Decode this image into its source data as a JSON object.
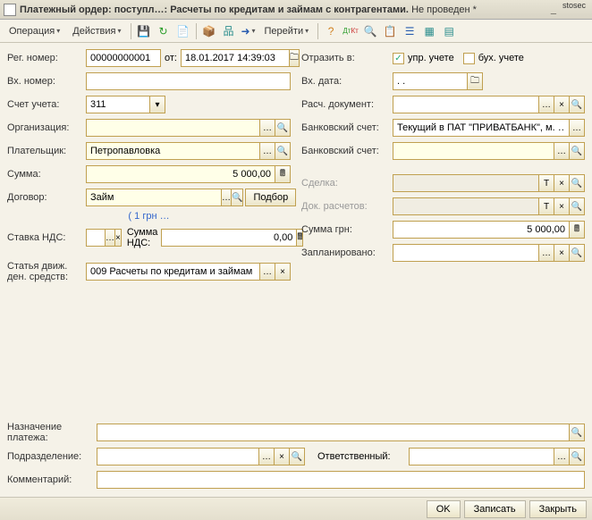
{
  "title": {
    "main": "Платежный ордер: поступл…: Расчеты по кредитам и займам с контрагентами.",
    "status": "Не проведен *",
    "brand": "stosec"
  },
  "menu": {
    "operation": "Операция",
    "actions": "Действия",
    "goto": "Перейти"
  },
  "labels": {
    "reg_no": "Рег. номер:",
    "from": "от:",
    "in_no": "Вх. номер:",
    "account": "Счет учета:",
    "org": "Организация:",
    "payer": "Плательщик:",
    "sum": "Сумма:",
    "contract": "Договор:",
    "select": "Подбор",
    "vat_rate": "Ставка НДС:",
    "vat_sum": "Сумма НДС:",
    "article1": "Статья движ.",
    "article2": "ден. средств:",
    "purpose1": "Назначение",
    "purpose2": "платежа:",
    "department": "Подразделение:",
    "comment": "Комментарий:",
    "reflect": "Отразить в:",
    "mgmt": "упр. учете",
    "acc": "бух. учете",
    "in_date": "Вх. дата:",
    "calc_doc": "Расч. документ:",
    "bank_acc": "Банковский счет:",
    "bank_acc2": "Банковский счет:",
    "deal": "Сделка:",
    "calc_docs": "Док. расчетов:",
    "sum_uah": "Сумма грн:",
    "planned": "Запланировано:",
    "responsible": "Ответственный:"
  },
  "values": {
    "reg_no": "00000000001",
    "date": "18.01.2017 14:39:03",
    "in_no": "",
    "account": "311",
    "org": "",
    "payer": "Петропавловка",
    "sum": "5 000,00",
    "contract": "Займ",
    "link": "( 1 грн …",
    "vat_rate": "",
    "vat_sum": "0,00",
    "article": "009 Расчеты по кредитам и займам …",
    "purpose": "",
    "department": "",
    "comment": "",
    "in_date": ". .",
    "calc_doc": "",
    "bank_acc": "Текущий в ПАТ \"ПРИВАТБАНК\", м. …",
    "bank_acc2": "",
    "deal": "",
    "calc_docs": "",
    "sum_uah": "5 000,00",
    "planned": "",
    "responsible": ""
  },
  "flags": {
    "mgmt_checked": "✓",
    "acc_checked": ""
  },
  "footer": {
    "ok": "OK",
    "save": "Записать",
    "close": "Закрыть"
  },
  "glyph": {
    "open": "…",
    "search": "🔍",
    "clear": "×",
    "dropdown": "▾",
    "cal": "📋",
    "t": "T"
  }
}
